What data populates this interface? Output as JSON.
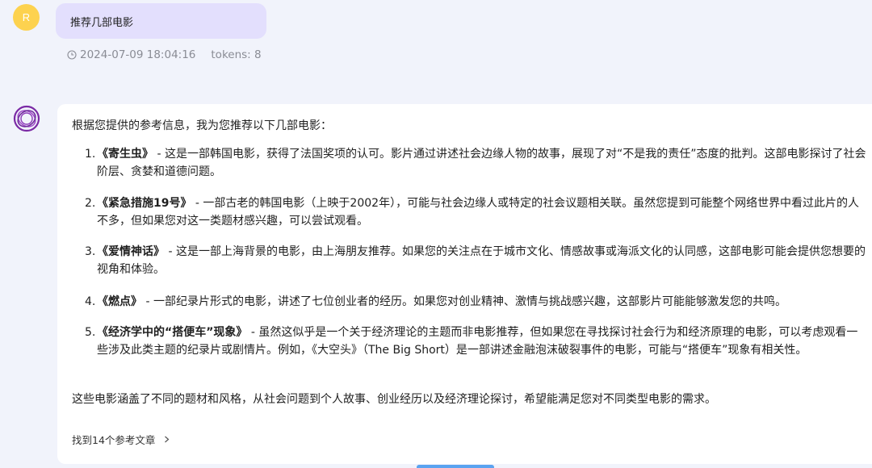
{
  "user": {
    "avatar_letter": "R",
    "message": "推荐几部电影",
    "timestamp": "2024-07-09 18:04:16",
    "tokens": "tokens: 8"
  },
  "answer": {
    "intro": "根据您提供的参考信息，我为您推荐以下几部电影：",
    "items": [
      {
        "num": "1.",
        "title": "《寄生虫》",
        "desc": " - 这是一部韩国电影，获得了法国奖项的认可。影片通过讲述社会边缘人物的故事，展现了对“不是我的责任”态度的批判。这部电影探讨了社会阶层、贪婪和道德问题。"
      },
      {
        "num": "2.",
        "title": "《紧急措施19号》",
        "desc": " - 一部古老的韩国电影（上映于2002年），可能与社会边缘人或特定的社会议题相关联。虽然您提到可能整个网络世界中看过此片的人不多，但如果您对这一类题材感兴趣，可以尝试观看。"
      },
      {
        "num": "3.",
        "title": "《爱情神话》",
        "desc": " - 这是一部上海背景的电影，由上海朋友推荐。如果您的关注点在于城市文化、情感故事或海派文化的认同感，这部电影可能会提供您想要的视角和体验。"
      },
      {
        "num": "4.",
        "title": "《燃点》",
        "desc": " - 一部纪录片形式的电影，讲述了七位创业者的经历。如果您对创业精神、激情与挑战感兴趣，这部影片可能能够激发您的共鸣。"
      },
      {
        "num": "5.",
        "title": "《经济学中的“搭便车”现象》",
        "desc": " - 虽然这似乎是一个关于经济理论的主题而非电影推荐，但如果您在寻找探讨社会行为和经济原理的电影，可以考虑观看一些涉及此类主题的纪录片或剧情片。例如，《大空头》（The Big Short）是一部讲述金融泡沫破裂事件的电影，可能与“搭便车”现象有相关性。"
      }
    ],
    "summary": "这些电影涵盖了不同的题材和风格，从社会问题到个人故事、创业经历以及经济理论探讨，希望能满足您对不同类型电影的需求。",
    "references": "找到14个参考文章"
  },
  "colors": {
    "background": "#f1f3fb",
    "user_bubble": "#e3dffd",
    "user_avatar": "#fdd24f",
    "bot_accent": "#7b2aa5",
    "meta_text": "#8a8c95"
  },
  "icons": {
    "clock": "clock-icon",
    "bot": "assistant-logo-icon",
    "chevron": "chevron-right-icon"
  }
}
